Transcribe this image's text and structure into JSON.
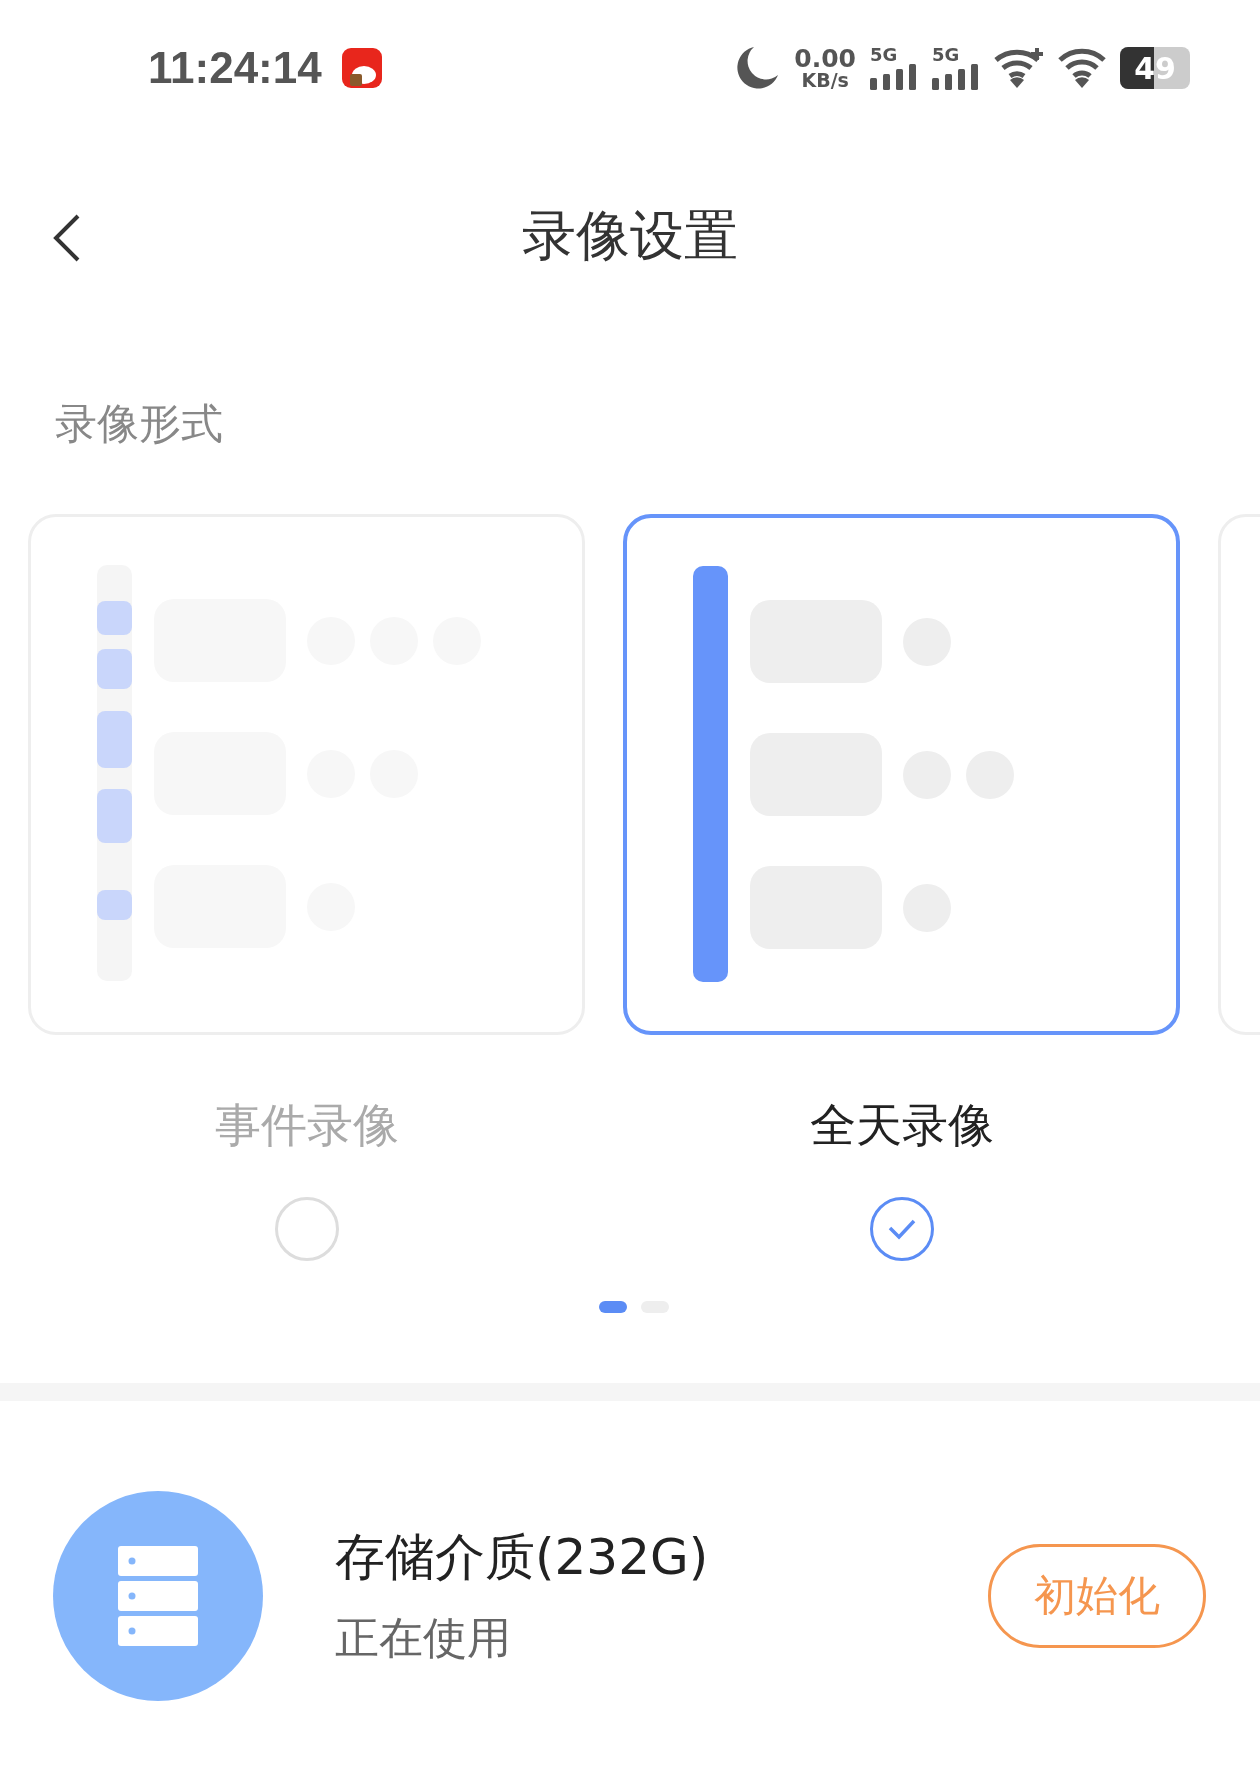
{
  "status_bar": {
    "time": "11:24:14",
    "net_speed": "0.00",
    "net_unit": "KB/s",
    "sims": [
      "5G",
      "5G"
    ],
    "battery": "49"
  },
  "header": {
    "title": "录像设置"
  },
  "section": {
    "label": "录像形式"
  },
  "modes": [
    {
      "kind": "event",
      "label": "事件录像",
      "selected": false
    },
    {
      "kind": "allday",
      "label": "全天录像",
      "selected": true
    }
  ],
  "more_cards": true,
  "pager": [
    {
      "selected": true
    },
    {
      "selected": false
    }
  ],
  "storage": {
    "title": "存储介质(232G)",
    "status": "正在使用",
    "button": "初始化"
  }
}
